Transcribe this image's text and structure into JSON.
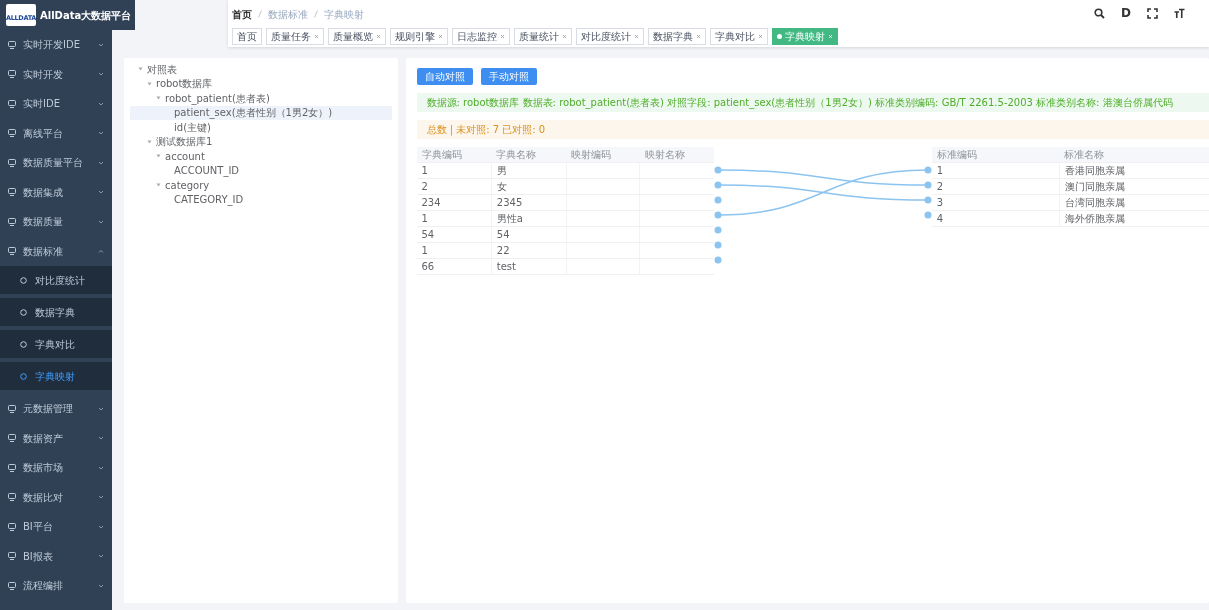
{
  "sidebar": {
    "logo_text": "AllData大数据平台",
    "logo_mark": "ALLDATA",
    "items": [
      {
        "label": "实时开发IDE",
        "expanded": false
      },
      {
        "label": "实时开发",
        "expanded": false
      },
      {
        "label": "实时IDE",
        "expanded": false
      },
      {
        "label": "离线平台",
        "expanded": false
      },
      {
        "label": "数据质量平台",
        "expanded": false
      },
      {
        "label": "数据集成",
        "expanded": false
      },
      {
        "label": "数据质量",
        "expanded": false
      },
      {
        "label": "数据标准",
        "expanded": true,
        "children": [
          {
            "label": "对比度统计",
            "selected": false
          },
          {
            "label": "数据字典",
            "selected": false
          },
          {
            "label": "字典对比",
            "selected": false
          },
          {
            "label": "字典映射",
            "selected": true
          }
        ]
      },
      {
        "label": "元数据管理",
        "expanded": false
      },
      {
        "label": "数据资产",
        "expanded": false
      },
      {
        "label": "数据市场",
        "expanded": false
      },
      {
        "label": "数据比对",
        "expanded": false
      },
      {
        "label": "BI平台",
        "expanded": false
      },
      {
        "label": "BI报表",
        "expanded": false
      },
      {
        "label": "流程编排",
        "expanded": false
      }
    ]
  },
  "breadcrumb": [
    "首页",
    "数据标准",
    "字典映射"
  ],
  "header_icons": {
    "doc_letter": "D"
  },
  "tabs": [
    {
      "label": "首页",
      "closable": false,
      "selected": false
    },
    {
      "label": "质量任务",
      "closable": true,
      "selected": false
    },
    {
      "label": "质量概览",
      "closable": true,
      "selected": false
    },
    {
      "label": "规则引擎",
      "closable": true,
      "selected": false
    },
    {
      "label": "日志监控",
      "closable": true,
      "selected": false
    },
    {
      "label": "质量统计",
      "closable": true,
      "selected": false
    },
    {
      "label": "对比度统计",
      "closable": true,
      "selected": false
    },
    {
      "label": "数据字典",
      "closable": true,
      "selected": false
    },
    {
      "label": "字典对比",
      "closable": true,
      "selected": false
    },
    {
      "label": "字典映射",
      "closable": true,
      "selected": true
    }
  ],
  "tree": [
    {
      "label": "对照表",
      "expanded": true,
      "selected": false,
      "children": [
        {
          "label": "robot数据库",
          "expanded": true,
          "selected": false,
          "children": [
            {
              "label": "robot_patient(患者表)",
              "expanded": true,
              "selected": false,
              "children": [
                {
                  "label": "patient_sex(患者性别（1男2女）)",
                  "selected": true
                },
                {
                  "label": "id(主键)",
                  "selected": false
                }
              ]
            }
          ]
        },
        {
          "label": "测试数据库1",
          "expanded": true,
          "selected": false,
          "children": [
            {
              "label": "account",
              "expanded": true,
              "selected": false,
              "children": [
                {
                  "label": "ACCOUNT_ID",
                  "selected": false
                }
              ]
            },
            {
              "label": "category",
              "expanded": true,
              "selected": false,
              "children": [
                {
                  "label": "CATEGORY_ID",
                  "selected": false
                }
              ]
            }
          ]
        }
      ]
    }
  ],
  "buttons": [
    "自动对照",
    "手动对照"
  ],
  "info_alert": "数据源: robot数据库 数据表: robot_patient(患者表) 对照字段: patient_sex(患者性别（1男2女）) 标准类别编码: GB/T 2261.5-2003 标准类别名称: 港澳台侨属代码",
  "count_alert": "总数 | 未对照: 7 已对照: 0",
  "left_table": {
    "columns": [
      "字典编码",
      "字典名称",
      "映射编码",
      "映射名称"
    ],
    "rows": [
      {
        "cells": [
          "1",
          "男",
          "",
          ""
        ],
        "links_to_standard": [
          false,
          true,
          false,
          false
        ]
      },
      {
        "cells": [
          "2",
          "女",
          "",
          ""
        ],
        "links_to_standard": [
          false,
          false,
          true,
          false
        ]
      },
      {
        "cells": [
          "234",
          "2345",
          "",
          ""
        ],
        "links_to_standard": [
          false,
          false,
          false,
          false
        ]
      },
      {
        "cells": [
          "1",
          "男性a",
          "",
          ""
        ],
        "links_to_standard": [
          true,
          false,
          false,
          false
        ]
      },
      {
        "cells": [
          "54",
          "54",
          "",
          ""
        ],
        "links_to_standard": [
          false,
          false,
          false,
          false
        ]
      },
      {
        "cells": [
          "1",
          "22",
          "",
          ""
        ],
        "links_to_standard": [
          false,
          false,
          false,
          false
        ]
      },
      {
        "cells": [
          "66",
          "test",
          "",
          ""
        ],
        "links_to_standard": [
          false,
          false,
          false,
          false
        ]
      }
    ]
  },
  "right_table": {
    "columns": [
      "标准编码",
      "标准名称"
    ],
    "rows": [
      [
        "1",
        "香港同胞亲属"
      ],
      [
        "2",
        "澳门同胞亲属"
      ],
      [
        "3",
        "台湾同胞亲属"
      ],
      [
        "4",
        "海外侨胞亲属"
      ]
    ]
  }
}
